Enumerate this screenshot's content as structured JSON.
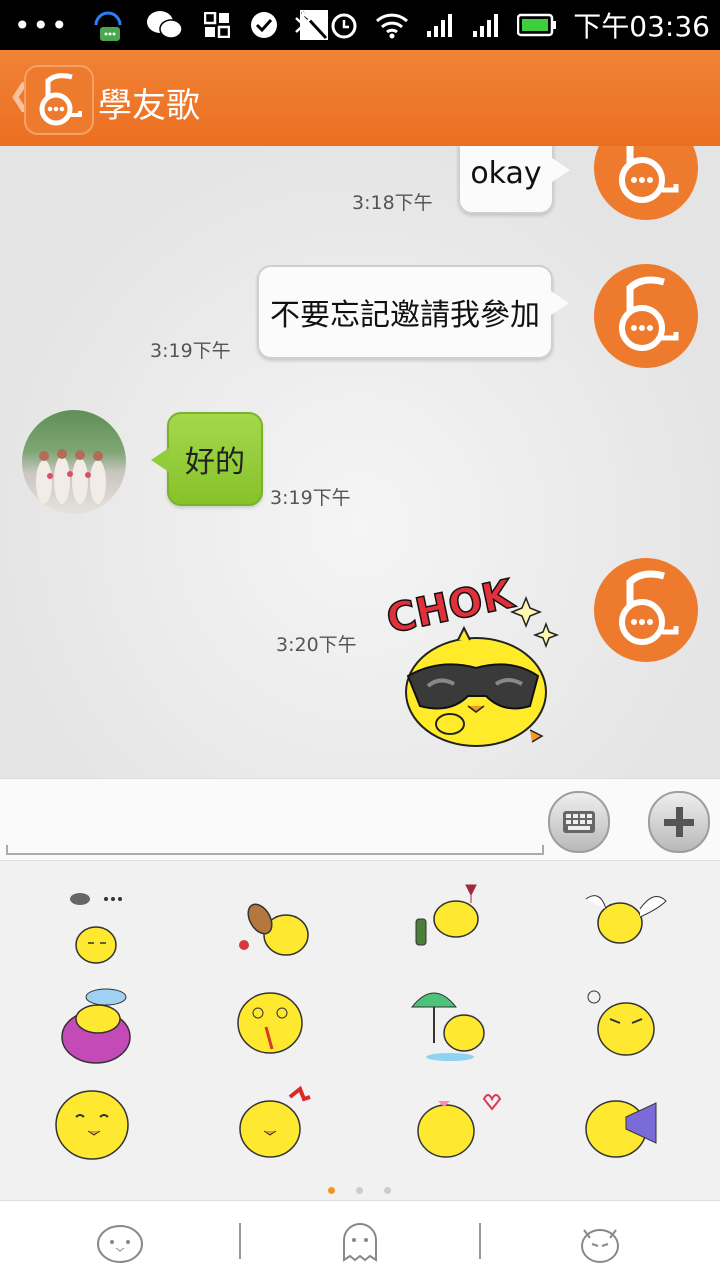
{
  "status_bar": {
    "time": "下午03:36",
    "icons": [
      "overflow-dots-icon",
      "headset-chat-icon",
      "wechat-icon",
      "grid-app-icon",
      "check-circle-icon",
      "no-sim-icon",
      "bluetooth-icon",
      "alarm-icon",
      "wifi-icon",
      "signal-icon",
      "signal-icon-2",
      "battery-icon"
    ]
  },
  "header": {
    "back_glyph": "❮",
    "title": "學友歌"
  },
  "messages": [
    {
      "type": "text",
      "direction": "out",
      "text": "okay",
      "time": "3:18下午"
    },
    {
      "type": "text",
      "direction": "out",
      "text": "不要忘記邀請我參加",
      "time": "3:19下午"
    },
    {
      "type": "text",
      "direction": "in",
      "text": "好的",
      "time": "3:19下午"
    },
    {
      "type": "sticker",
      "direction": "out",
      "sticker_text": "CHOK",
      "time": "3:20下午"
    }
  ],
  "input_bar": {
    "text_value": "",
    "keyboard_button": "keyboard-icon",
    "add_button": "plus-icon"
  },
  "sticker_panel": {
    "stickers": [
      "chick-thinking",
      "chick-guitar",
      "chick-wine",
      "chick-angel-wings",
      "chick-blanket-cold",
      "chick-dizzy-nosebleed",
      "chick-umbrella-rain",
      "chick-angry",
      "chick-crying",
      "chick-bow",
      "chick-love",
      "chick-megaphone"
    ],
    "page_count": 3,
    "active_page": 1
  },
  "tabs": [
    "chick-face-tab-1",
    "chick-ghost-tab-2",
    "chick-devil-tab-3"
  ],
  "colors": {
    "header": "#ee7428",
    "incoming_bubble": "#93cc3a",
    "active_dot": "#f7941d"
  }
}
